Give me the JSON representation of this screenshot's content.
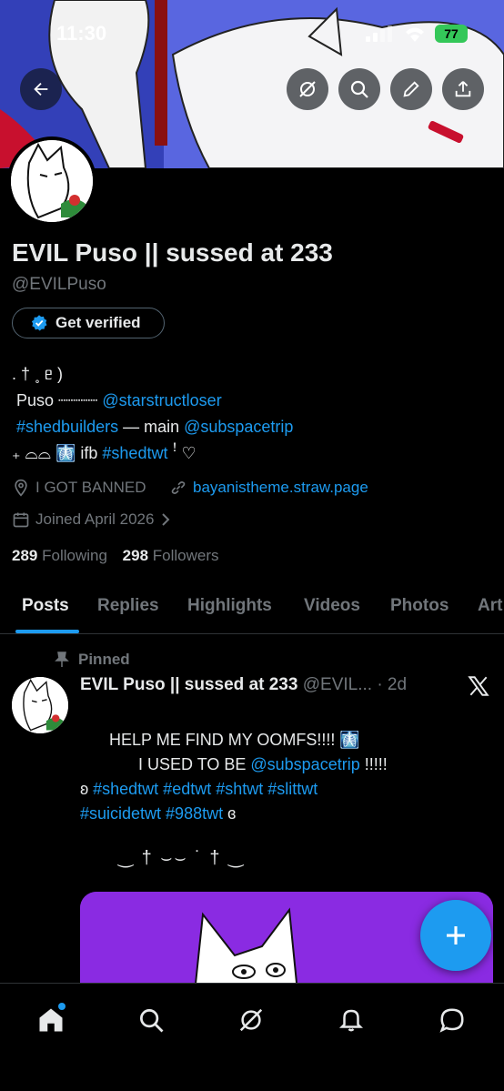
{
  "status_bar": {
    "time": "11:30",
    "battery": "77"
  },
  "profile": {
    "display_name": "EVIL Puso || sussed at 233",
    "handle": "@EVILPuso",
    "verify_label": "Get verified",
    "bio": {
      "line1": ". † ˳ ᥱ )",
      "line2_prefix": "Puso ┈┈┈┈ ",
      "line2_link": "@starstructloser",
      "line3_tag": "#shedbuilders",
      "line3_mid": " — main ",
      "line3_link": "@subspacetrip",
      "line4_prefix": "₊ ⌓⌓ 🩻 ifb ",
      "line4_tag": "#shedtwt",
      "line4_suffix": "  ꜝ ♡"
    },
    "location": "I GOT BANNED",
    "website": "bayanistheme.straw.page",
    "joined": "Joined April 2026",
    "following_count": "289",
    "following_label": "Following",
    "followers_count": "298",
    "followers_label": "Followers"
  },
  "tabs": [
    "Posts",
    "Replies",
    "Highlights",
    "Videos",
    "Photos",
    "Art"
  ],
  "pinned_post": {
    "pinned_label": "Pinned",
    "author": "EVIL Puso || sussed at 233",
    "handle_time": "@EVIL... · 2d",
    "line1": "HELP ME FIND MY OOMFS!!!!  🩻",
    "line2_prefix": "I USED TO BE ",
    "line2_link": "@subspacetrip",
    "line2_suffix": " !!!!!",
    "line3_prefix": "ʚ  ",
    "line3_tags": "#shedtwt #edtwt #shtwt  #slittwt",
    "line4_tags": "#suicidetwt #988twt",
    "line4_suffix": "  ɞ",
    "deco": "‿   †    ⌣⌣   ˙ †  ‿"
  },
  "colors": {
    "accent": "#1d9bf0",
    "background": "#000000",
    "text": "#e7e9ea",
    "muted": "#71767b"
  },
  "icons": [
    "back-arrow-icon",
    "grok-icon",
    "search-icon",
    "edit-icon",
    "share-icon",
    "verified-badge-icon",
    "location-icon",
    "link-icon",
    "calendar-icon",
    "chevron-right-icon",
    "pin-icon",
    "x-logo-icon",
    "plus-icon",
    "home-icon",
    "explore-icon",
    "notifications-icon",
    "messages-icon"
  ]
}
